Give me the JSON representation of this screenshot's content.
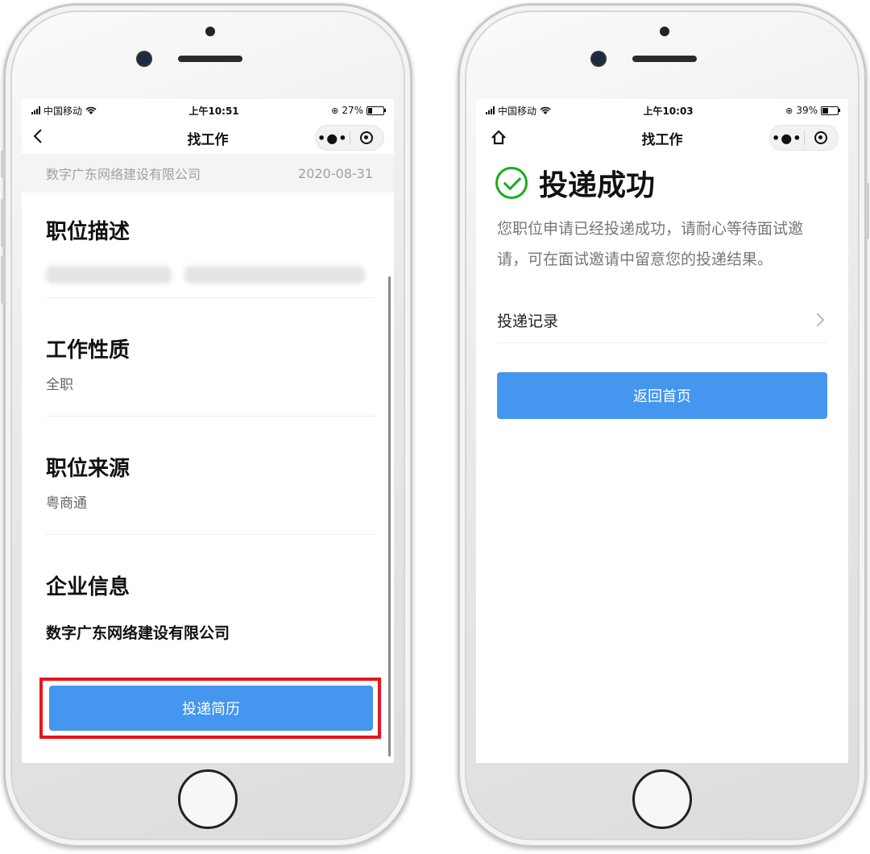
{
  "left_phone": {
    "status": {
      "carrier": "中国移动",
      "time": "上午10:51",
      "battery": "27%",
      "battery_level": 0.27
    },
    "nav": {
      "title": "找工作"
    },
    "company_row": {
      "company": "数字广东网络建设有限公司",
      "date": "2020-08-31"
    },
    "sections": {
      "description": {
        "title": "职位描述"
      },
      "nature": {
        "title": "工作性质",
        "value": "全职"
      },
      "source": {
        "title": "职位来源",
        "value": "粤商通"
      },
      "enterprise": {
        "title": "企业信息",
        "value": "数字广东网络建设有限公司"
      }
    },
    "apply_button": "投递简历",
    "highlight_color": "#e8141d"
  },
  "right_phone": {
    "status": {
      "carrier": "中国移动",
      "time": "上午10:03",
      "battery": "39%",
      "battery_level": 0.39
    },
    "nav": {
      "title": "找工作"
    },
    "success": {
      "title": "投递成功",
      "description": "您职位申请已经投递成功，请耐心等待面试邀请，可在面试邀请中留意您的投递结果。"
    },
    "record_row": "投递记录",
    "home_button": "返回首页"
  },
  "colors": {
    "primary": "#4496ef",
    "success": "#1aad19"
  },
  "icons": [
    "signal-icon",
    "wifi-icon",
    "battery-icon",
    "back-icon",
    "home-icon",
    "more-icon",
    "target-icon",
    "check-circle-icon",
    "chevron-right-icon"
  ]
}
